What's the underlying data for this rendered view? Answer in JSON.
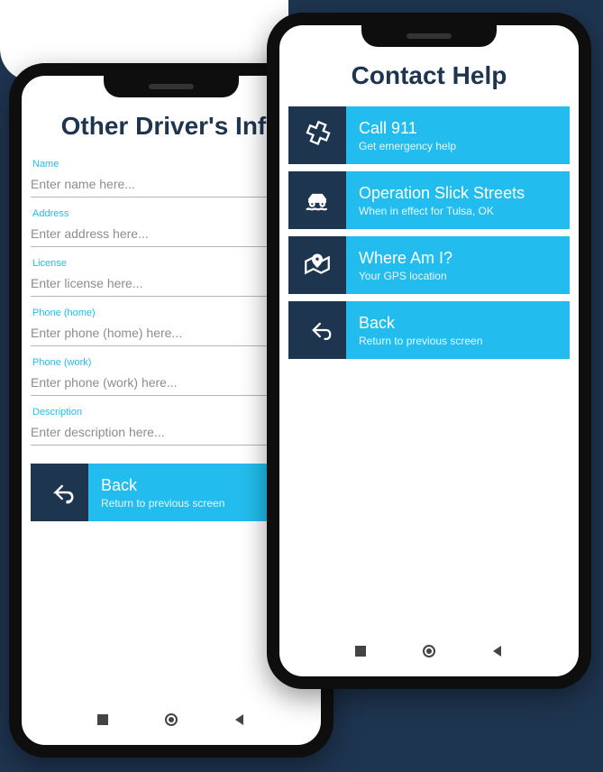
{
  "screens": {
    "driverInfo": {
      "title": "Other Driver's Info",
      "fields": {
        "name": {
          "label": "Name",
          "placeholder": "Enter name here..."
        },
        "address": {
          "label": "Address",
          "placeholder": "Enter address here..."
        },
        "license": {
          "label": "License",
          "placeholder": "Enter license here..."
        },
        "phone_home": {
          "label": "Phone (home)",
          "placeholder": "Enter phone (home) here..."
        },
        "phone_work": {
          "label": "Phone (work)",
          "placeholder": "Enter phone (work) here..."
        },
        "description": {
          "label": "Description",
          "placeholder": "Enter description here..."
        }
      },
      "back": {
        "title": "Back",
        "sub": "Return to previous screen"
      }
    },
    "contactHelp": {
      "title": "Contact Help",
      "items": {
        "call911": {
          "title": "Call 911",
          "sub": "Get emergency help"
        },
        "slick": {
          "title": "Operation Slick Streets",
          "sub": "When in effect for Tulsa, OK"
        },
        "where": {
          "title": "Where Am I?",
          "sub": "Your GPS location"
        },
        "back": {
          "title": "Back",
          "sub": "Return to previous screen"
        }
      }
    }
  }
}
